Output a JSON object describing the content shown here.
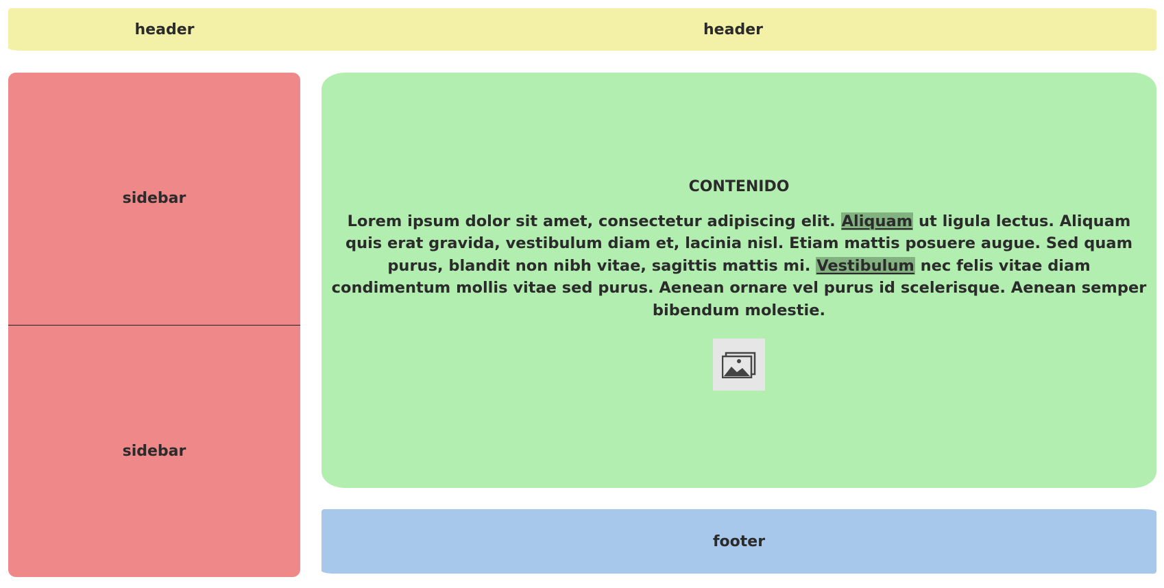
{
  "colors": {
    "header_bg": "#f3f1a7",
    "sidebar_bg": "#ef8989",
    "content_bg": "#b3eeb1",
    "footer_bg": "#a7c7eb",
    "highlight_bg": "#82b27f",
    "image_bg": "#e6e6e6",
    "image_icon": "#444444"
  },
  "header": {
    "left_label": "header",
    "right_label": "header"
  },
  "sidebar": {
    "top_label": "sidebar",
    "bottom_label": "sidebar"
  },
  "content": {
    "title": "CONTENIDO",
    "text_part1": "Lorem ipsum dolor sit amet, consectetur adipiscing elit. ",
    "highlight1": "Aliquam",
    "text_part2": " ut ligula lectus. Aliquam quis erat gravida, vestibulum diam et, lacinia nisl. Etiam mattis posuere augue. Sed quam purus, blandit non nibh vitae, sagittis mattis mi. ",
    "highlight2": "Vestibulum",
    "text_part3": " nec felis vitae diam condimentum mollis vitae sed purus. Aenean ornare vel purus id scelerisque. Aenean semper bibendum molestie.",
    "image_icon": "image-icon"
  },
  "footer": {
    "label": "footer"
  }
}
